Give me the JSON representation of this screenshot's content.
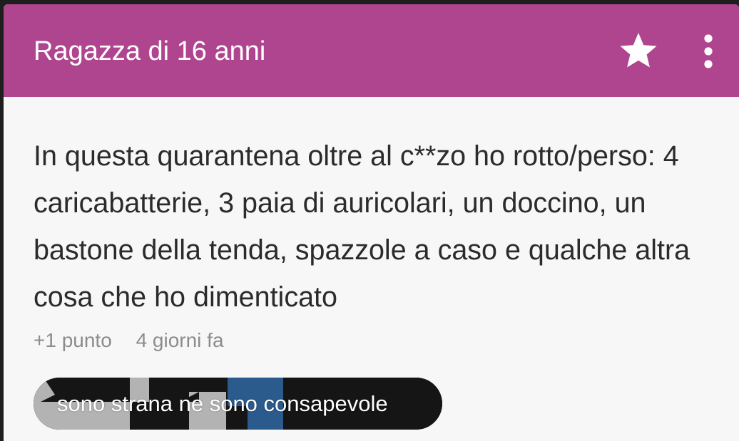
{
  "header": {
    "title": "Ragazza di 16 anni",
    "favorite_icon": "star-icon",
    "menu_icon": "more-vertical-icon"
  },
  "post": {
    "text": "In questa quarantena oltre al c**zo ho rotto/perso: 4 caricabatterie, 3 paia di auricolari, un doccino, un bastone della tenda, spazzole a caso e qualche altra cosa che ho dimenticato",
    "points": "+1 punto",
    "time": "4 giorni fa"
  },
  "tag": {
    "label": "sono strana ne sono consapevole"
  },
  "colors": {
    "header": "#b0458f",
    "card": "#f7f7f7",
    "text": "#2b2b2b",
    "meta": "#8c8c8c",
    "chip": "#151515",
    "chip_accent_blue": "#2b5a8c",
    "chip_accent_gray": "#b3b3b3"
  }
}
